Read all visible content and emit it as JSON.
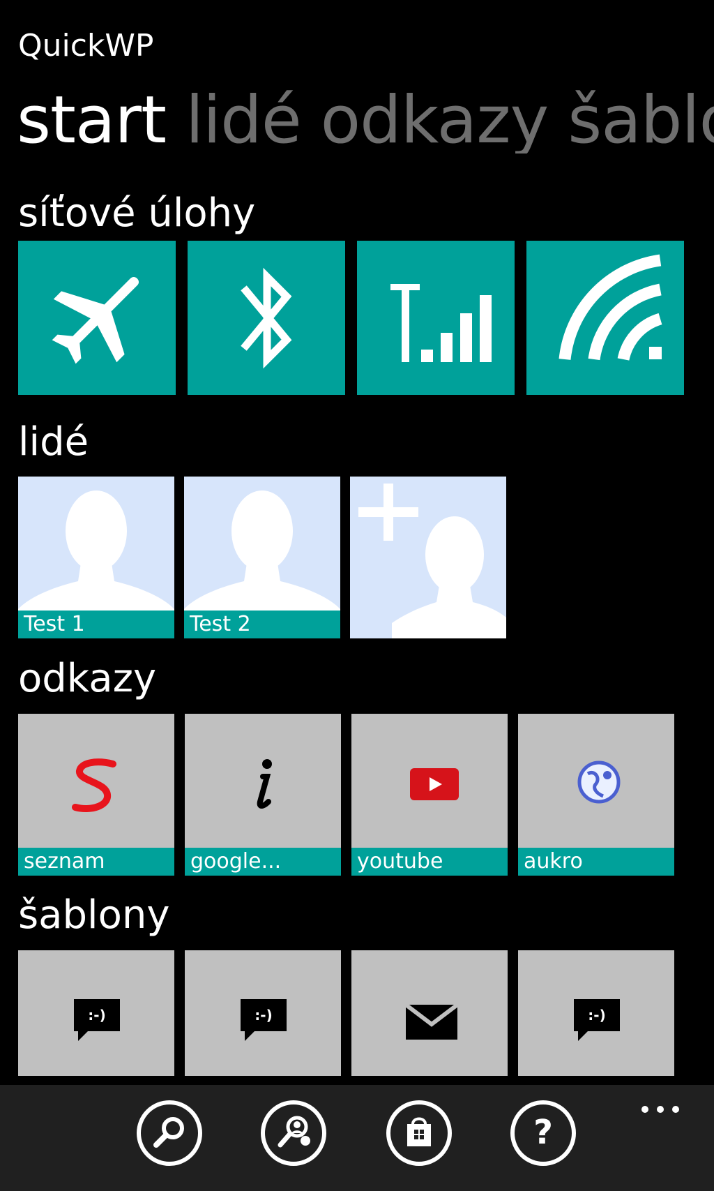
{
  "app": {
    "title": "QuickWP"
  },
  "pivot": {
    "items": [
      {
        "label": "start",
        "active": true
      },
      {
        "label": "lidé",
        "active": false
      },
      {
        "label": "odkazy",
        "active": false
      },
      {
        "label": "šablony",
        "active": false
      }
    ]
  },
  "sections": {
    "network": {
      "title": "síťové úlohy",
      "tiles": [
        "airplane-icon",
        "bluetooth-icon",
        "cellular-signal-icon",
        "wifi-icon"
      ]
    },
    "people": {
      "title": "lidé",
      "tiles": [
        {
          "label": "Test 1",
          "icon": "person-icon"
        },
        {
          "label": "Test 2",
          "icon": "person-icon"
        },
        {
          "label": "",
          "icon": "add-person-icon"
        }
      ]
    },
    "links": {
      "title": "odkazy",
      "tiles": [
        {
          "label": "seznam",
          "icon": "seznam-logo-icon"
        },
        {
          "label": "google...",
          "icon": "info-icon"
        },
        {
          "label": "youtube",
          "icon": "youtube-icon"
        },
        {
          "label": "aukro",
          "icon": "globe-icon"
        }
      ]
    },
    "templates": {
      "title": "šablony",
      "tiles": [
        "sms-smiley-icon",
        "sms-smiley-icon",
        "email-icon",
        "sms-smiley-icon"
      ]
    }
  },
  "appbar": {
    "buttons": [
      "search-icon",
      "search-people-icon",
      "store-icon",
      "help-icon"
    ],
    "more": "more-icon"
  },
  "colors": {
    "accent": "#00a19a",
    "tile_gray": "#c0c0c0",
    "person_bg": "#d7e5fb",
    "background": "#000000",
    "inactive_pivot": "#6e6e6e"
  }
}
